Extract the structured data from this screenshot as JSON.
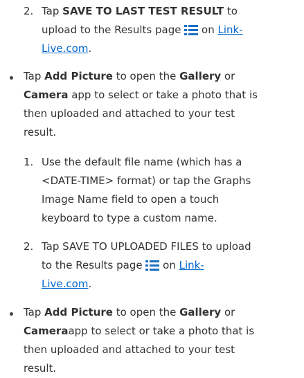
{
  "steps_a": {
    "step_2": {
      "number": "2.",
      "text_before": "Tap ",
      "action": "SAVE TO LAST TEST RESULT",
      "text_after": " to",
      "line_2_before": "upload to the Results page",
      "line_2_after": "on",
      "link_part_1": "Link-",
      "link_part_2": "Live.com",
      "period": "."
    }
  },
  "bullet_1": {
    "line_1_before": "Tap ",
    "add_picture": "Add Picture",
    "line_1_mid": " to open the ",
    "gallery": "Gallery",
    "line_1_end": " or",
    "camera": "Camera",
    "line_2_after": " app to select or take a photo that is",
    "line_3": "then uploaded and attached to your test",
    "line_4": "result."
  },
  "steps_b": {
    "step_1": {
      "number": "1.",
      "line_1": "Use the default file name (which has a",
      "line_2": "<DATE-TIME> format) or tap the Graphs",
      "line_3": "Image Name field to open a touch",
      "line_4": "keyboard to type a custom name."
    },
    "step_2": {
      "number": "2.",
      "line_1": "Tap SAVE TO UPLOADED FILES to upload",
      "line_2_before": "to the Results page",
      "line_2_after": "on",
      "link_part_1": "Link-",
      "link_part_2": "Live.com",
      "period": "."
    }
  },
  "bullet_2": {
    "line_1_before": "Tap ",
    "add_picture": "Add Picture",
    "line_1_mid": " to open the ",
    "gallery": "Gallery",
    "line_1_end": " or",
    "camera": "Camera",
    "line_2_after": "app to select or take a photo that is",
    "line_3": "then uploaded and attached to your test",
    "line_4": "result."
  },
  "icons": {
    "results_icon": "results-list-icon",
    "bullet_icon": "bullet-dot-icon"
  },
  "colors": {
    "text": "#333333",
    "link": "#0066cc",
    "icon": "#1a6fc4"
  }
}
